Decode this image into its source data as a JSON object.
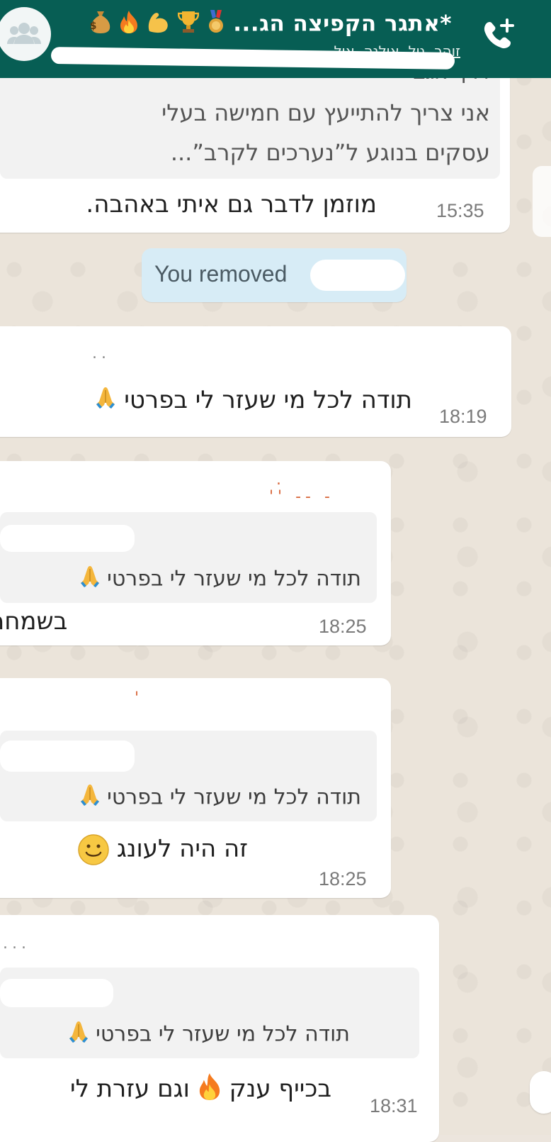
{
  "header": {
    "title": "*אתגר הקפיצה הג...",
    "subtitle": "זוהר, גיל, אילנה, איל, ...",
    "emojis": [
      "medal-icon",
      "trophy-icon",
      "muscle-icon",
      "fire-icon",
      "money-bag-icon"
    ],
    "accent": "#075e54"
  },
  "messages": [
    {
      "partial_line": "דרך אגב",
      "line1": "אני צריך להתייעץ עם חמישה בעלי",
      "line2": "עסקים בנוגע ל”נערכים לקרב”...",
      "text": "מוזמן לדבר גם איתי באהבה.",
      "time": "15:35"
    },
    {
      "system": "You removed"
    },
    {
      "text": "תודה לכל מי שעזר לי בפרטי",
      "time": "18:19"
    },
    {
      "quote": "תודה לכל מי שעזר לי בפרטי",
      "text": "בשמחה",
      "time": "18:25"
    },
    {
      "quote": "תודה לכל מי שעזר לי בפרטי",
      "text": "זה היה לעונג",
      "time": "18:25"
    },
    {
      "quote": "תודה לכל מי שעזר לי בפרטי",
      "text_a": "בכייף ענק",
      "text_b": "וגם עזרת לי",
      "time": "18:31"
    }
  ]
}
